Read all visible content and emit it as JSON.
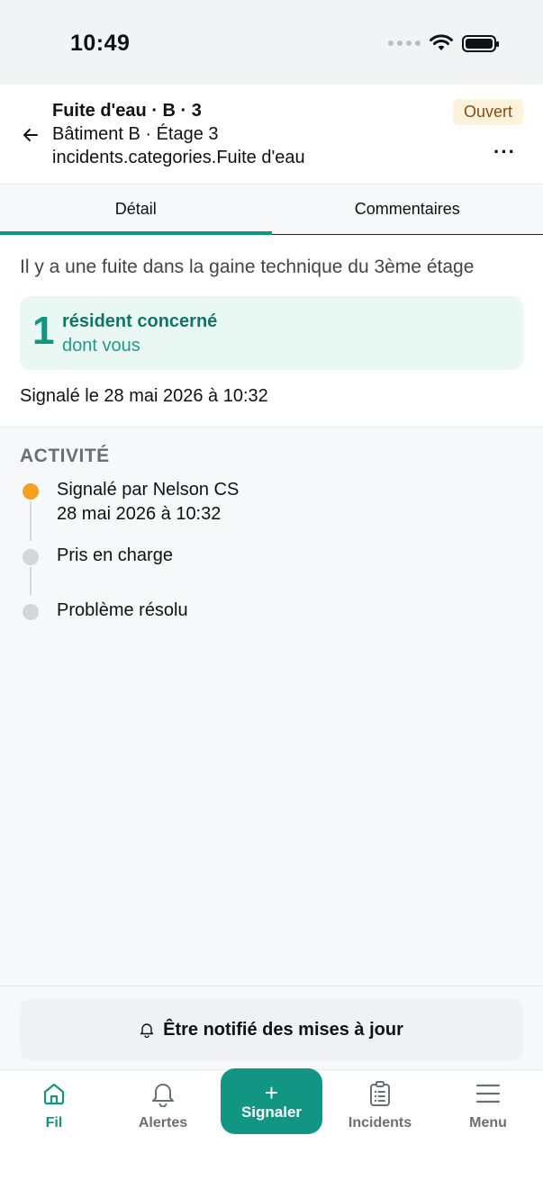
{
  "status_bar": {
    "time": "10:49"
  },
  "header": {
    "title": "Fuite d'eau · B · 3",
    "subtitle_location": "Bâtiment B · Étage 3",
    "subtitle_category": "incidents.categories.Fuite d'eau",
    "status": "Ouvert",
    "more_label": "···"
  },
  "tabs": [
    {
      "label": "Détail",
      "active": true
    },
    {
      "label": "Commentaires",
      "active": false
    }
  ],
  "detail": {
    "description": "Il y a une fuite dans la gaine technique du 3ème étage",
    "residents": {
      "count": "1",
      "label": "résident concerné",
      "sub": "dont vous"
    },
    "reported": "Signalé le 28 mai 2026 à 10:32"
  },
  "activity": {
    "title": "ACTIVITÉ",
    "events": [
      {
        "title": "Signalé par Nelson CS",
        "date": "28 mai 2026 à 10:32",
        "done": true
      },
      {
        "title": "Pris en charge",
        "date": "",
        "done": false
      },
      {
        "title": "Problème résolu",
        "date": "",
        "done": false
      }
    ]
  },
  "notify": {
    "label": "Être notifié des mises à jour"
  },
  "bottom_nav": {
    "items": [
      {
        "label": "Fil",
        "icon": "home-icon",
        "active": true
      },
      {
        "label": "Alertes",
        "icon": "bell-icon",
        "active": false
      },
      {
        "label": "Signaler",
        "icon": "plus-icon",
        "active": false
      },
      {
        "label": "Incidents",
        "icon": "clipboard-icon",
        "active": false
      },
      {
        "label": "Menu",
        "icon": "menu-icon",
        "active": false
      }
    ]
  },
  "colors": {
    "accent": "#119683",
    "status_badge_bg": "#fdf3dc",
    "status_badge_text": "#8a4b10",
    "event_done": "#f4a11d",
    "event_pending": "#d4d6da"
  }
}
